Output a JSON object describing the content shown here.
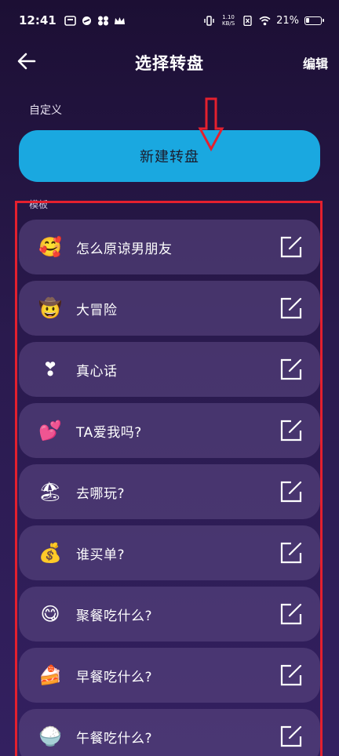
{
  "status_bar": {
    "time": "12:41",
    "net_speed_value": "1.10",
    "net_speed_unit": "KB/S",
    "battery": "21%",
    "battery_level": 0.21
  },
  "header": {
    "title": "选择转盘",
    "edit_label": "编辑",
    "back_icon": "arrow-left-icon"
  },
  "custom_section": {
    "label": "自定义",
    "new_button_label": "新建转盘"
  },
  "template_section": {
    "label": "模板",
    "items": [
      {
        "emoji": "🥰",
        "label": "怎么原谅男朋友"
      },
      {
        "emoji": "🤠",
        "label": "大冒险"
      },
      {
        "emoji": "❣",
        "label": "真心话"
      },
      {
        "emoji": "💕",
        "label": "TA爱我吗?"
      },
      {
        "emoji": "🏖",
        "label": "去哪玩?"
      },
      {
        "emoji": "💰",
        "label": "谁买单?"
      },
      {
        "emoji": "😋",
        "label": "聚餐吃什么?"
      },
      {
        "emoji": "🍰",
        "label": "早餐吃什么?"
      },
      {
        "emoji": "🍚",
        "label": "午餐吃什么?"
      }
    ]
  },
  "colors": {
    "accent_button": "#1aa8e0",
    "annotation_red": "#e4202e",
    "background_top": "#1c0f34",
    "list_item_bg": "#584680"
  }
}
